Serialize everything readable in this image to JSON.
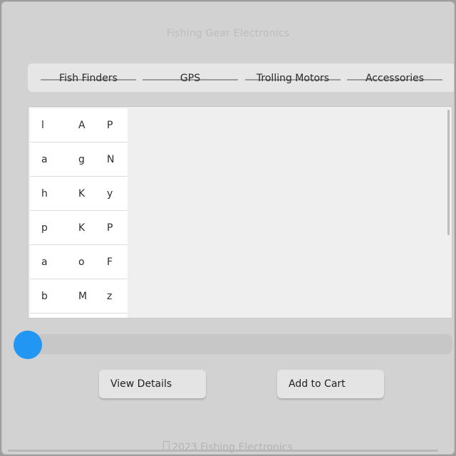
{
  "app": {
    "title": "Fishing Gear Electronics"
  },
  "tabs": [
    {
      "label": "Fish Finders"
    },
    {
      "label": "GPS"
    },
    {
      "label": "Trolling Motors"
    },
    {
      "label": "Accessories"
    }
  ],
  "grid": {
    "rows": [
      [
        "l",
        "A",
        "P"
      ],
      [
        "a",
        "g",
        "N"
      ],
      [
        "h",
        "K",
        "y"
      ],
      [
        "p",
        "K",
        "P"
      ],
      [
        "a",
        "o",
        "F"
      ],
      [
        "b",
        "M",
        "z"
      ]
    ]
  },
  "slider": {
    "value": 0,
    "accent_color": "#2196f3"
  },
  "actions": {
    "view_details": "View Details",
    "add_to_cart": "Add to Cart"
  },
  "footer": {
    "text": "2023 Fishing Electronics",
    "icon": "copyright-icon"
  }
}
